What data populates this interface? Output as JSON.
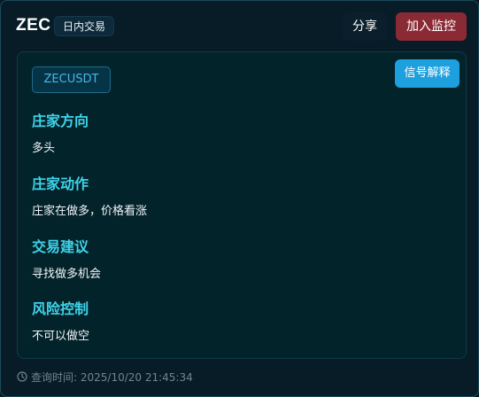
{
  "header": {
    "symbol": "ZEC",
    "tag": "日内交易",
    "share_label": "分享",
    "monitor_label": "加入监控"
  },
  "panel": {
    "pair": "ZECUSDT",
    "explain_label": "信号解释",
    "sections": [
      {
        "title": "庄家方向",
        "text": "多头"
      },
      {
        "title": "庄家动作",
        "text": "庄家在做多，价格看涨"
      },
      {
        "title": "交易建议",
        "text": "寻找做多机会"
      },
      {
        "title": "风险控制",
        "text": "不可以做空"
      }
    ]
  },
  "footer": {
    "query_time": "查询时间: 2025/10/20 21:45:34"
  },
  "colors": {
    "background": "#071c27",
    "panel": "#02232a",
    "accent_cyan": "#3fd3ea",
    "explain_button": "#1ea0de",
    "monitor_button": "#8a2a35",
    "pair_text": "#49b6e3"
  },
  "icons": {
    "footer_icon": "clock-icon"
  }
}
